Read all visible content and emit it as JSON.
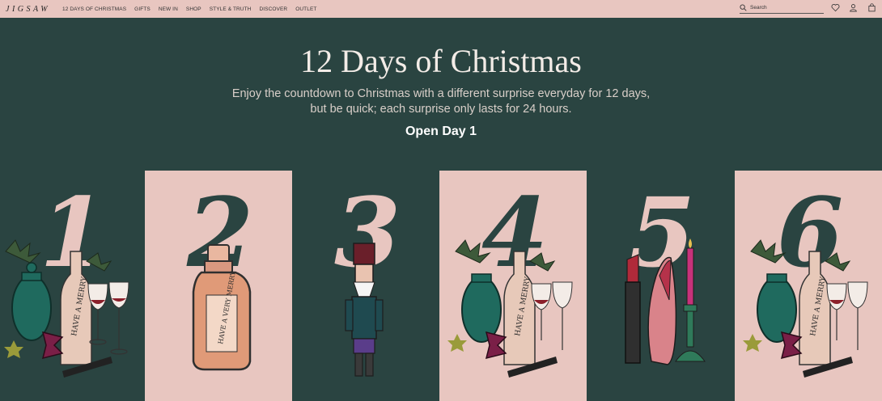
{
  "brand": {
    "logo": "JIGSAW"
  },
  "nav": {
    "items": [
      "12 DAYS OF CHRISTMAS",
      "GIFTS",
      "NEW IN",
      "SHOP",
      "STYLE & TRUTH",
      "DISCOVER",
      "OUTLET"
    ]
  },
  "search": {
    "placeholder": "Search"
  },
  "hero": {
    "title": "12 Days of Christmas",
    "subtitle_line1": "Enjoy the countdown to Christmas with a different surprise everyday for 12 days,",
    "subtitle_line2": "but be quick; each surprise only lasts for 24 hours.",
    "open_label": "Open Day 1"
  },
  "doors": [
    {
      "number": "1",
      "bg": "#2a4441",
      "num_color": "#e8c6c0",
      "illustration": "wine-and-vase"
    },
    {
      "number": "2",
      "bg": "#e8c6c0",
      "num_color": "#2a4441",
      "illustration": "perfume-bottle"
    },
    {
      "number": "3",
      "bg": "#2a4441",
      "num_color": "#e8c6c0",
      "illustration": "nutcracker"
    },
    {
      "number": "4",
      "bg": "#e8c6c0",
      "num_color": "#2a4441",
      "illustration": "wine-and-vase"
    },
    {
      "number": "5",
      "bg": "#2a4441",
      "num_color": "#e8c6c0",
      "illustration": "lipstick-heel-candle"
    },
    {
      "number": "6",
      "bg": "#e8c6c0",
      "num_color": "#2a4441",
      "illustration": "wine-and-vase"
    }
  ],
  "colors": {
    "green": "#2a4441",
    "pink": "#e8c6c0"
  }
}
